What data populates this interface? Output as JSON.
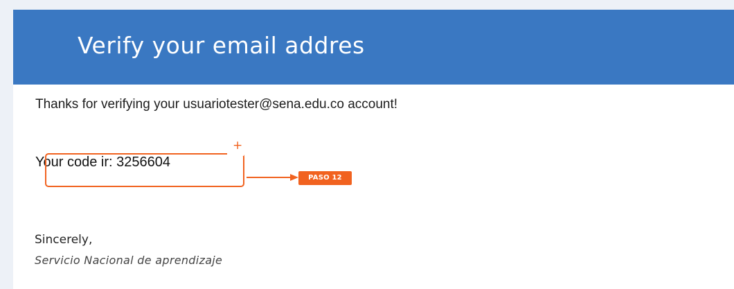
{
  "header": {
    "title": "Verify your email addres"
  },
  "body": {
    "thanks": "Thanks for verifying your usuariotester@sena.edu.co account!",
    "code_line": "Your code ir: 3256604",
    "sincerely": "Sincerely,",
    "organization": "Servicio Nacional de aprendizaje"
  },
  "annotation": {
    "plus_symbol": "+",
    "step_label": "PASO 12",
    "color": "#f1621f"
  },
  "colors": {
    "header_bg": "#3a78c2",
    "page_bg": "#edf1f7",
    "card_bg": "#ffffff"
  },
  "icons": {
    "pointer": "arrow-right-icon"
  }
}
